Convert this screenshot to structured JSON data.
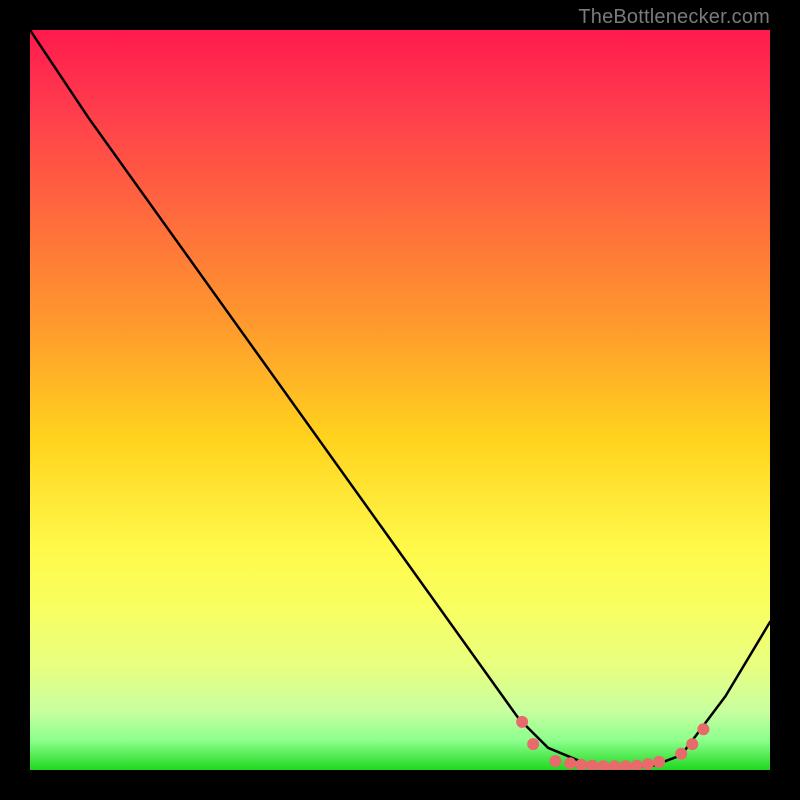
{
  "attribution": "TheBottlenecker.com",
  "chart_data": {
    "type": "line",
    "title": "",
    "xlabel": "",
    "ylabel": "",
    "xlim": [
      0,
      100
    ],
    "ylim": [
      0,
      100
    ],
    "curve": [
      {
        "x": 0,
        "y": 100
      },
      {
        "x": 4,
        "y": 94
      },
      {
        "x": 8,
        "y": 88
      },
      {
        "x": 66,
        "y": 7
      },
      {
        "x": 70,
        "y": 3
      },
      {
        "x": 76,
        "y": 0.5
      },
      {
        "x": 84,
        "y": 0.5
      },
      {
        "x": 88,
        "y": 2
      },
      {
        "x": 94,
        "y": 10
      },
      {
        "x": 100,
        "y": 20
      }
    ],
    "markers": [
      {
        "x": 66.5,
        "y": 6.5
      },
      {
        "x": 68,
        "y": 3.5
      },
      {
        "x": 71,
        "y": 1.2
      },
      {
        "x": 73,
        "y": 0.9
      },
      {
        "x": 74.5,
        "y": 0.7
      },
      {
        "x": 76,
        "y": 0.6
      },
      {
        "x": 77.5,
        "y": 0.5
      },
      {
        "x": 79,
        "y": 0.5
      },
      {
        "x": 80.5,
        "y": 0.5
      },
      {
        "x": 82,
        "y": 0.6
      },
      {
        "x": 83.5,
        "y": 0.8
      },
      {
        "x": 85,
        "y": 1.1
      },
      {
        "x": 88,
        "y": 2.2
      },
      {
        "x": 89.5,
        "y": 3.5
      },
      {
        "x": 91,
        "y": 5.5
      }
    ],
    "colors": {
      "curve": "#000000",
      "marker": "#e86a6a"
    }
  }
}
